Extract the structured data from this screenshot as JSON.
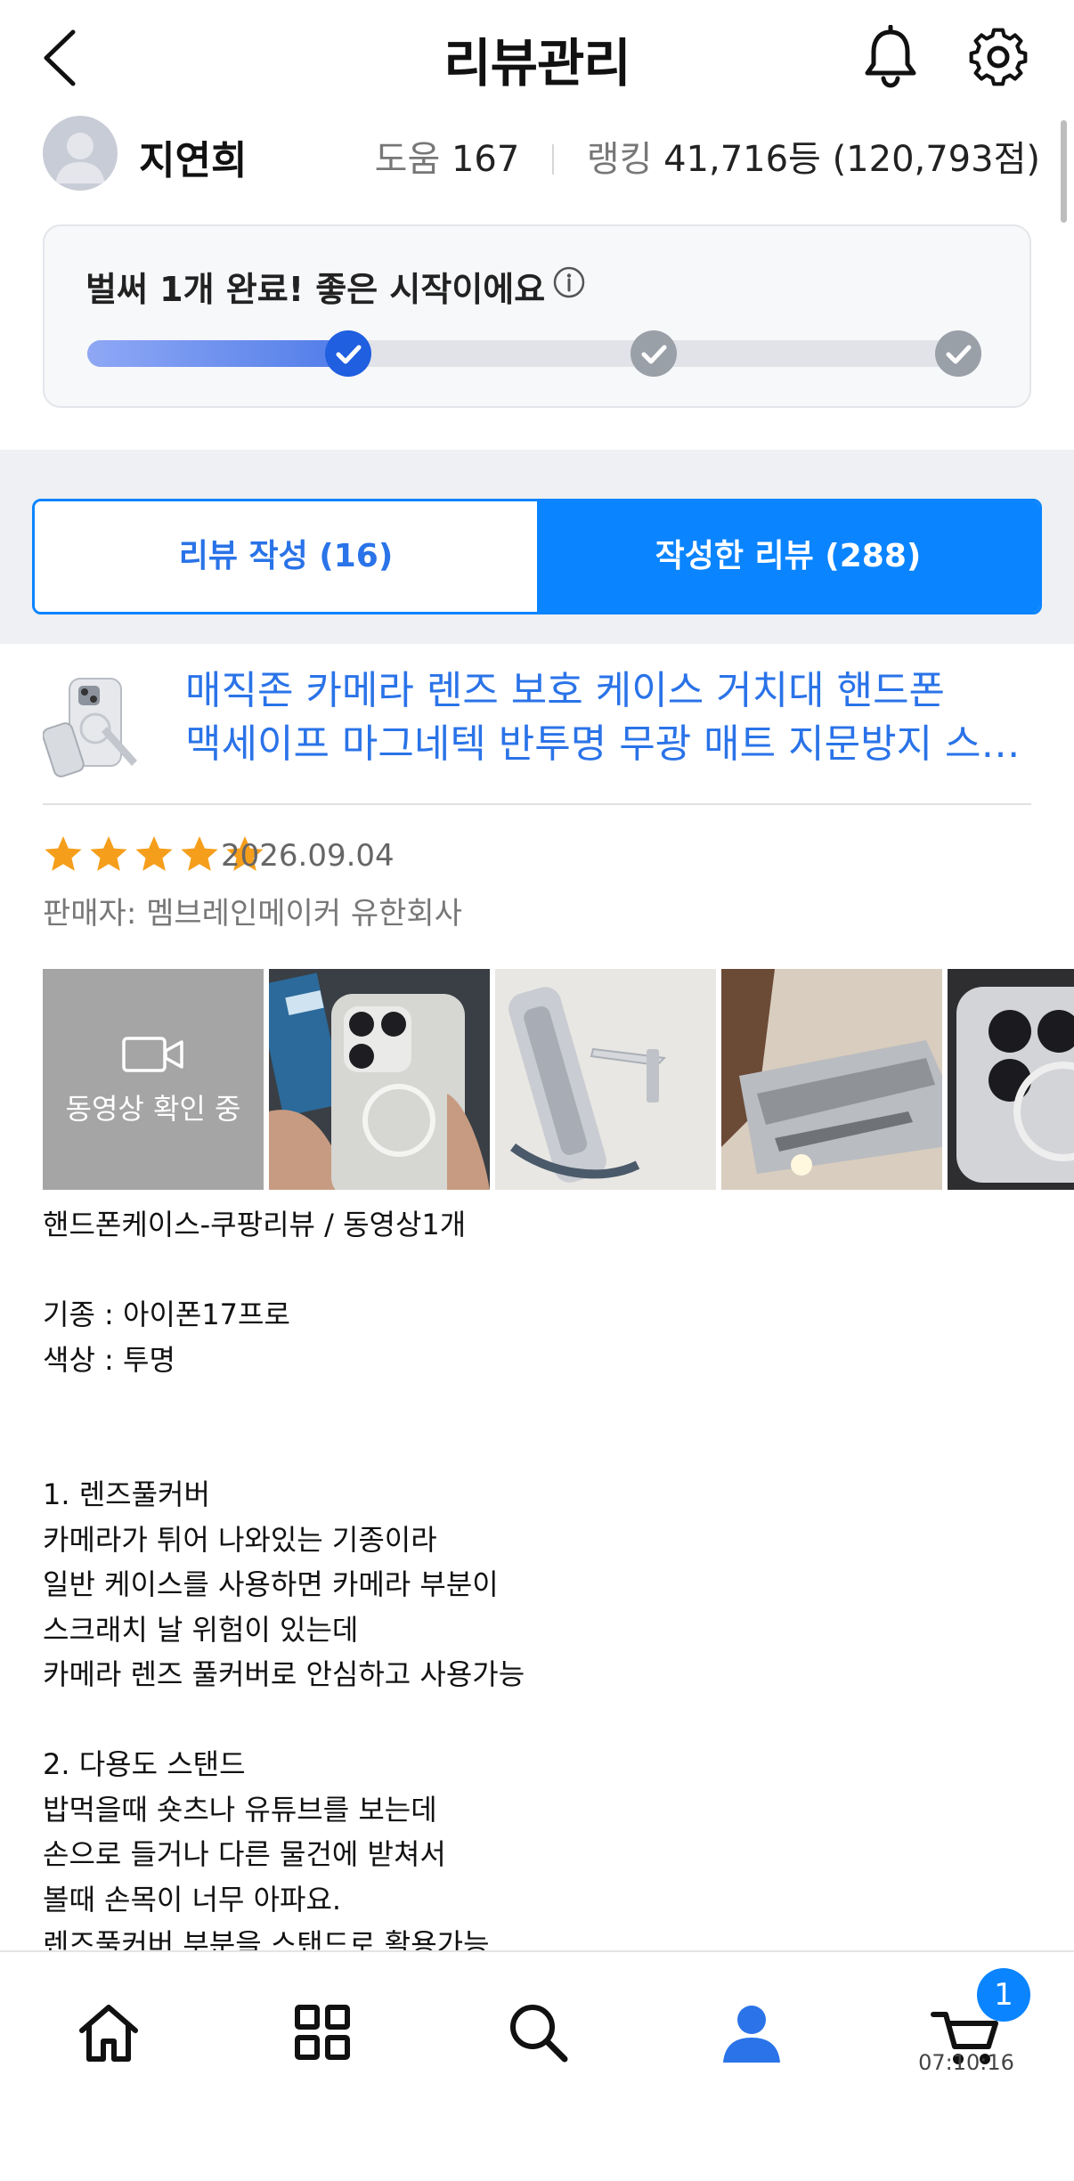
{
  "header": {
    "title": "리뷰관리",
    "back_icon": "chevron-left-icon",
    "bell_icon": "bell-icon",
    "settings_icon": "gear-icon"
  },
  "profile": {
    "name": "지연희",
    "help_label": "도움",
    "help_value": "167",
    "rank_label": "랭킹",
    "rank_value": "41,716등 (120,793점)"
  },
  "progress": {
    "message": "벌써 1개 완료! 좋은 시작이에요",
    "completed_steps": 1,
    "total_steps": 3,
    "info_icon": "info-icon"
  },
  "tabs": [
    {
      "label": "리뷰 작성 (16)",
      "active": false
    },
    {
      "label": "작성한 리뷰 (288)",
      "active": true
    }
  ],
  "product": {
    "name_line1": "매직존 카메라 렌즈 보호 케이스 거치대 핸드폰",
    "name_line2": "맥세이프 마그네텍 반투명 무광 매트 지문방지 스…"
  },
  "rating": {
    "stars": 5,
    "max": 5,
    "date": "2026.09.04",
    "seller": "판매자: 멤브레인메이커 유한회사"
  },
  "media": {
    "video_label": "동영상 확인 중"
  },
  "review_lines": [
    "핸드폰케이스-쿠팡리뷰 / 동영상1개",
    "",
    "기종 : 아이폰17프로",
    "색상 : 투명",
    "",
    "",
    "1. 렌즈풀커버",
    "카메라가 튀어 나와있는 기종이라",
    "일반 케이스를 사용하면 카메라 부분이",
    "스크래치 날 위험이 있는데",
    "카메라 렌즈 풀커버로 안심하고 사용가능",
    "",
    "2. 다용도 스탠드",
    "밥먹을때 숏츠나 유튜브를 보는데",
    "손으로 들거나 다른 물건에 받쳐서",
    "볼때 손목이 너무 아파요.",
    "렌즈풀커버 부분을 스탠드로 활용가능"
  ],
  "bottom_nav": {
    "items": [
      "home-icon",
      "categories-icon",
      "search-icon",
      "my-page-icon",
      "cart-icon"
    ],
    "cart_badge": "1",
    "cart_time": "07:10:16"
  },
  "colors": {
    "accent": "#0a84ff",
    "link": "#2a73e8",
    "star": "#f59e1b",
    "progress_fill": "#4e7be8",
    "step_done": "#1f5fe0",
    "step_pending": "#9aa0a8"
  }
}
